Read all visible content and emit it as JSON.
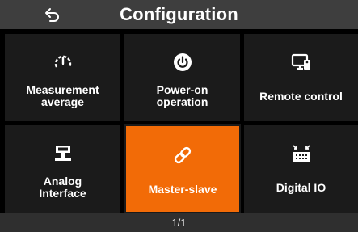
{
  "header": {
    "title": "Configuration",
    "back_icon": "back-arrow-icon"
  },
  "tiles": [
    {
      "label": "Measurement\naverage",
      "icon": "gauge-icon"
    },
    {
      "label": "Power-on\noperation",
      "icon": "power-icon"
    },
    {
      "label": "Remote control",
      "icon": "remote-control-icon"
    },
    {
      "label": "Analog\nInterface",
      "icon": "analog-interface-icon"
    },
    {
      "label": "Master-slave",
      "icon": "link-icon",
      "selected": true
    },
    {
      "label": "Digital IO",
      "icon": "digital-io-icon"
    }
  ],
  "footer": {
    "page_indicator": "1/1"
  },
  "colors": {
    "accent": "#f26b07",
    "tile_bg": "#1b1b1b",
    "header_bg": "#3e3e3e",
    "footer_bg": "#2f2f2f"
  }
}
